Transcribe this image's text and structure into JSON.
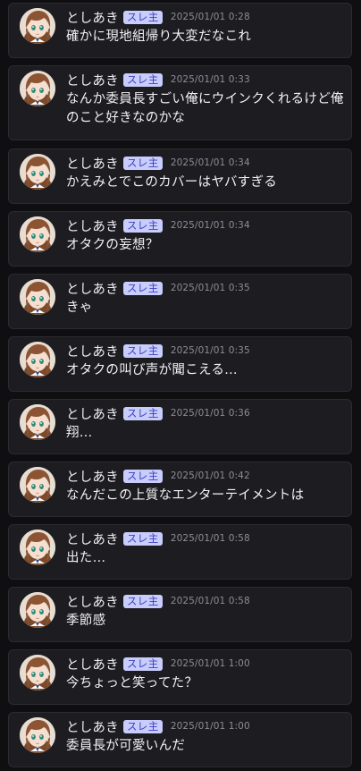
{
  "posts": [
    {
      "name": "としあき",
      "badge": "スレ主",
      "time": "2025/01/01 0:28",
      "text": "確かに現地組帰り大変だなこれ"
    },
    {
      "name": "としあき",
      "badge": "スレ主",
      "time": "2025/01/01 0:33",
      "text": "なんか委員長すごい俺にウインクくれるけど俺のこと好きなのかな"
    },
    {
      "name": "としあき",
      "badge": "スレ主",
      "time": "2025/01/01 0:34",
      "text": "かえみとでこのカバーはヤバすぎる"
    },
    {
      "name": "としあき",
      "badge": "スレ主",
      "time": "2025/01/01 0:34",
      "text": "オタクの妄想？"
    },
    {
      "name": "としあき",
      "badge": "スレ主",
      "time": "2025/01/01 0:35",
      "text": "きゃ"
    },
    {
      "name": "としあき",
      "badge": "スレ主",
      "time": "2025/01/01 0:35",
      "text": "オタクの叫び声が聞こえる…"
    },
    {
      "name": "としあき",
      "badge": "スレ主",
      "time": "2025/01/01 0:36",
      "text": "翔…"
    },
    {
      "name": "としあき",
      "badge": "スレ主",
      "time": "2025/01/01 0:42",
      "text": "なんだこの上質なエンターテイメントは"
    },
    {
      "name": "としあき",
      "badge": "スレ主",
      "time": "2025/01/01 0:58",
      "text": "出た…"
    },
    {
      "name": "としあき",
      "badge": "スレ主",
      "time": "2025/01/01 0:58",
      "text": "季節感"
    },
    {
      "name": "としあき",
      "badge": "スレ主",
      "time": "2025/01/01 1:00",
      "text": "今ちょっと笑ってた？"
    },
    {
      "name": "としあき",
      "badge": "スレ主",
      "time": "2025/01/01 1:00",
      "text": "委員長が可愛いんだ"
    }
  ],
  "colors": {
    "background": "#0f0f12",
    "card": "#1c1c21",
    "badge_bg": "#c9cdfb",
    "badge_text": "#3a3fc4",
    "timestamp": "#8d8d96"
  },
  "avatar_icon": "anime-girl-avatar-icon"
}
